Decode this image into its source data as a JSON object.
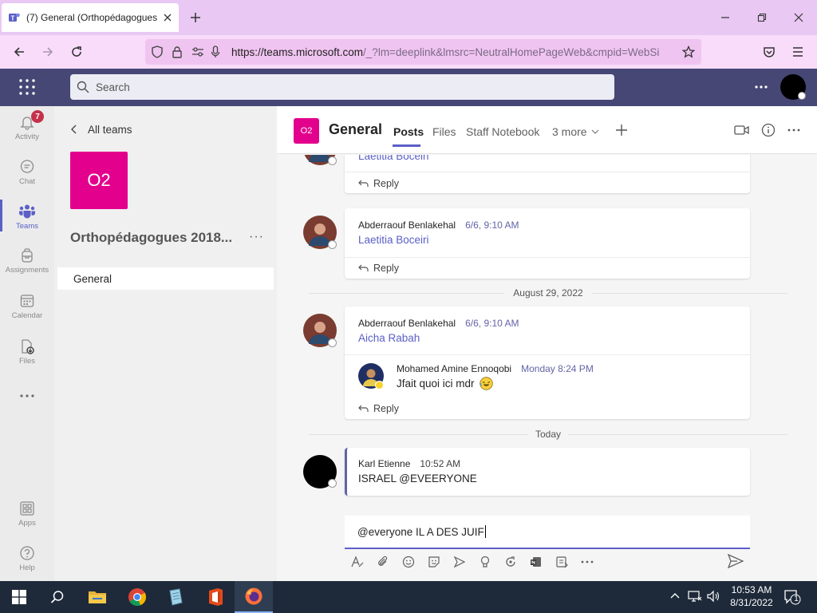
{
  "browser": {
    "tab_title": "(7) General (Orthopédagogues",
    "url_host": "https://teams.microsoft.com",
    "url_path": "/_?lm=deeplink&lmsrc=NeutralHomePageWeb&cmpid=WebSi"
  },
  "teams": {
    "search_placeholder": "Search",
    "rail": [
      {
        "label": "Activity",
        "icon": "bell-icon",
        "badge": "7"
      },
      {
        "label": "Chat",
        "icon": "chat-icon"
      },
      {
        "label": "Teams",
        "icon": "teams-icon"
      },
      {
        "label": "Assignments",
        "icon": "backpack-icon"
      },
      {
        "label": "Calendar",
        "icon": "calendar-icon"
      },
      {
        "label": "Files",
        "icon": "file-icon"
      },
      {
        "label": "Apps",
        "icon": "apps-icon"
      },
      {
        "label": "Help",
        "icon": "help-icon"
      }
    ],
    "panel": {
      "back_label": "All teams",
      "team_initials": "O2",
      "team_name": "Orthopédagogues 2018...",
      "more": "···",
      "channels": [
        "General"
      ]
    },
    "channel": {
      "initials": "O2",
      "title": "General",
      "tabs": [
        "Posts",
        "Files",
        "Staff Notebook",
        "3 more"
      ],
      "accent": "#5b5fc7"
    },
    "feed": {
      "posts": [
        {
          "mention": "Laetitia Boceiri",
          "reply": "Reply"
        },
        {
          "author": "Abderraouf Benlakehal",
          "time": "6/6, 9:10 AM",
          "mention": "Laetitia Boceiri",
          "reply": "Reply"
        },
        {
          "author": "Abderraouf Benlakehal",
          "time": "6/6, 9:10 AM",
          "mention": "Aicha Rabah",
          "replies": [
            {
              "author": "Mohamed Amine Ennoqobi",
              "time": "Monday 8:24 PM",
              "text": "Jfait quoi ici mdr"
            }
          ],
          "reply": "Reply"
        },
        {
          "author": "Karl Etienne",
          "time": "10:52 AM",
          "text": "ISRAEL @EVEERYONE"
        }
      ],
      "date_separators": [
        "August 29, 2022",
        "Today"
      ]
    },
    "compose_text": "@everyone IL A DES JUIF"
  },
  "taskbar": {
    "time": "10:53 AM",
    "date": "8/31/2022",
    "notifications": "1"
  }
}
